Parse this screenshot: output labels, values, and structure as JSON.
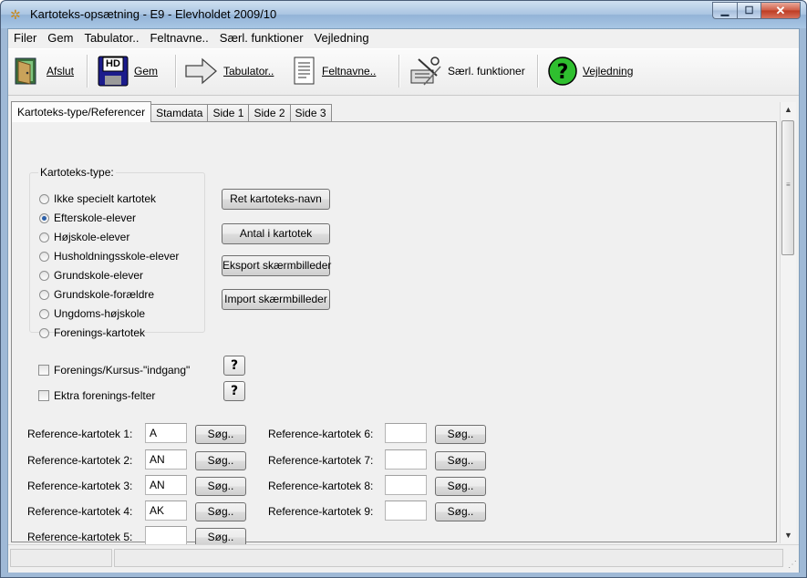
{
  "window": {
    "title": "Kartoteks-opsætning - E9 - Elevholdet 2009/10"
  },
  "menu": [
    "Filer",
    "Gem",
    "Tabulator..",
    "Feltnavne..",
    "Særl. funktioner",
    "Vejledning"
  ],
  "toolbar": {
    "afslut": "Afslut",
    "gem": "Gem",
    "tabulator": "Tabulator..",
    "feltnavne": "Feltnavne..",
    "saerl": "Særl. funktioner",
    "vejledning": "Vejledning",
    "hd_text": "HD"
  },
  "tabs": [
    "Kartoteks-type/Referencer",
    "Stamdata",
    "Side 1",
    "Side 2",
    "Side 3"
  ],
  "kartotekstype": {
    "label": "Kartoteks-type:",
    "options": [
      "Ikke specielt kartotek",
      "Efterskole-elever",
      "Højskole-elever",
      "Husholdningsskole-elever",
      "Grundskole-elever",
      "Grundskole-forældre",
      "Ungdoms-højskole",
      "Forenings-kartotek"
    ],
    "selected_index": 1
  },
  "actions": {
    "ret_navn": "Ret kartoteks-navn",
    "antal": "Antal i kartotek",
    "eksport": "Eksport skærmbilleder",
    "import": "Import skærmbilleder"
  },
  "checks": {
    "indgang": "Forenings/Kursus-\"indgang\"",
    "ekstra": "Ektra forenings-felter",
    "help": "?"
  },
  "references": {
    "search_label": "Søg..",
    "left": [
      {
        "label": "Reference-kartotek 1:",
        "value": "A"
      },
      {
        "label": "Reference-kartotek 2:",
        "value": "AN"
      },
      {
        "label": "Reference-kartotek 3:",
        "value": "AN"
      },
      {
        "label": "Reference-kartotek 4:",
        "value": "AK"
      },
      {
        "label": "Reference-kartotek 5:",
        "value": ""
      }
    ],
    "right": [
      {
        "label": "Reference-kartotek 6:",
        "value": ""
      },
      {
        "label": "Reference-kartotek 7:",
        "value": ""
      },
      {
        "label": "Reference-kartotek 8:",
        "value": ""
      },
      {
        "label": "Reference-kartotek 9:",
        "value": ""
      }
    ]
  }
}
